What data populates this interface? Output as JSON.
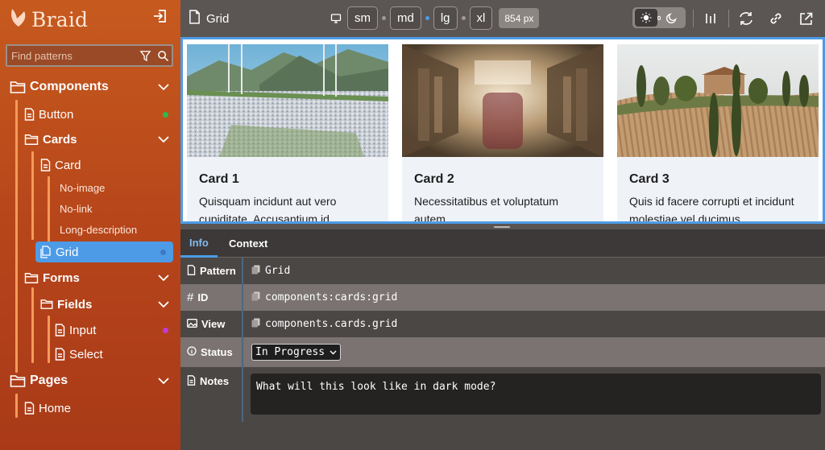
{
  "brand": {
    "name": "Braid"
  },
  "search": {
    "placeholder": "Find patterns"
  },
  "tree": {
    "components": "Components",
    "button": "Button",
    "cards": "Cards",
    "card": "Card",
    "no_image": "No-image",
    "no_link": "No-link",
    "long_description": "Long-description",
    "grid": "Grid",
    "forms": "Forms",
    "fields": "Fields",
    "input": "Input",
    "select": "Select",
    "pages": "Pages",
    "home": "Home"
  },
  "toolbar": {
    "title": "Grid",
    "breakpoints": [
      "sm",
      "md",
      "lg",
      "xl"
    ],
    "width_readout": "854 px"
  },
  "cards": [
    {
      "title": "Card 1",
      "text": "Quisquam incidunt aut vero cupiditate. Accusantium id"
    },
    {
      "title": "Card 2",
      "text": "Necessitatibus et voluptatum autem."
    },
    {
      "title": "Card 3",
      "text": "Quis id facere corrupti et incidunt molestiae vel ducimus"
    }
  ],
  "panel": {
    "tabs": [
      "Info",
      "Context"
    ],
    "pattern_label": "Pattern",
    "pattern_value": "Grid",
    "id_label": "ID",
    "id_value": "components:cards:grid",
    "view_label": "View",
    "view_value": "components.cards.grid",
    "status_label": "Status",
    "status_value": "In Progress",
    "notes_label": "Notes",
    "notes_value": "What will this look like in dark mode?"
  },
  "colors": {
    "sidebar": "#b5441a",
    "accent": "#4d9be6",
    "status_dot_button": "#2fb84a",
    "status_dot_grid": "#3c78c0",
    "status_dot_input": "#c13bd4"
  }
}
